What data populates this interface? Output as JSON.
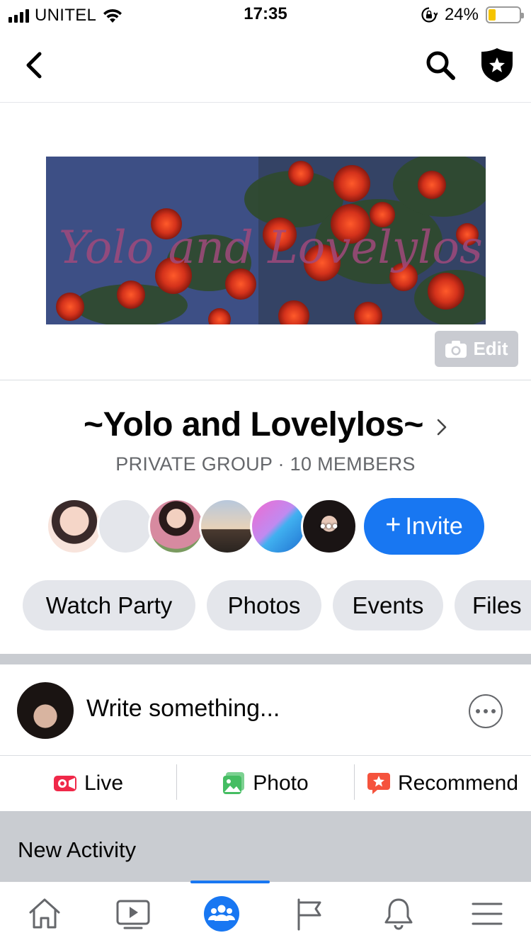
{
  "status_bar": {
    "carrier": "UNITEL",
    "time": "17:35",
    "battery_percent": "24%",
    "battery_level": 0.24,
    "icons": [
      "signal-icon",
      "wifi-icon",
      "orientation-lock-icon",
      "battery-icon"
    ]
  },
  "nav": {
    "icons": [
      "back-chevron-icon",
      "search-icon",
      "admin-shield-icon"
    ]
  },
  "cover": {
    "edit_label": "Edit",
    "edit_icon": "camera-icon"
  },
  "group": {
    "name": "~Yolo and Lovelylos~",
    "meta": "PRIVATE GROUP · 10 MEMBERS",
    "invite_label": "Invite",
    "invite_plus": "+",
    "more_members": "•••"
  },
  "chips": [
    {
      "label": "Watch Party"
    },
    {
      "label": "Photos"
    },
    {
      "label": "Events"
    },
    {
      "label": "Files"
    }
  ],
  "composer": {
    "placeholder": "Write something..."
  },
  "post_actions": [
    {
      "label": "Live",
      "icon": "live-video-icon",
      "color": "#f02849"
    },
    {
      "label": "Photo",
      "icon": "photo-icon",
      "color": "#45bd62"
    },
    {
      "label": "Recommend",
      "icon": "recommend-icon",
      "color": "#f5533d"
    }
  ],
  "activity": {
    "heading": "New Activity"
  },
  "tab_bar": {
    "items": [
      {
        "icon": "home-icon"
      },
      {
        "icon": "watch-icon"
      },
      {
        "icon": "groups-icon",
        "active": true
      },
      {
        "icon": "pages-flag-icon"
      },
      {
        "icon": "notifications-bell-icon"
      },
      {
        "icon": "menu-icon"
      }
    ]
  },
  "colors": {
    "accent": "#1877f2",
    "chip_bg": "#e4e6eb",
    "secondary_text": "#65676b"
  }
}
